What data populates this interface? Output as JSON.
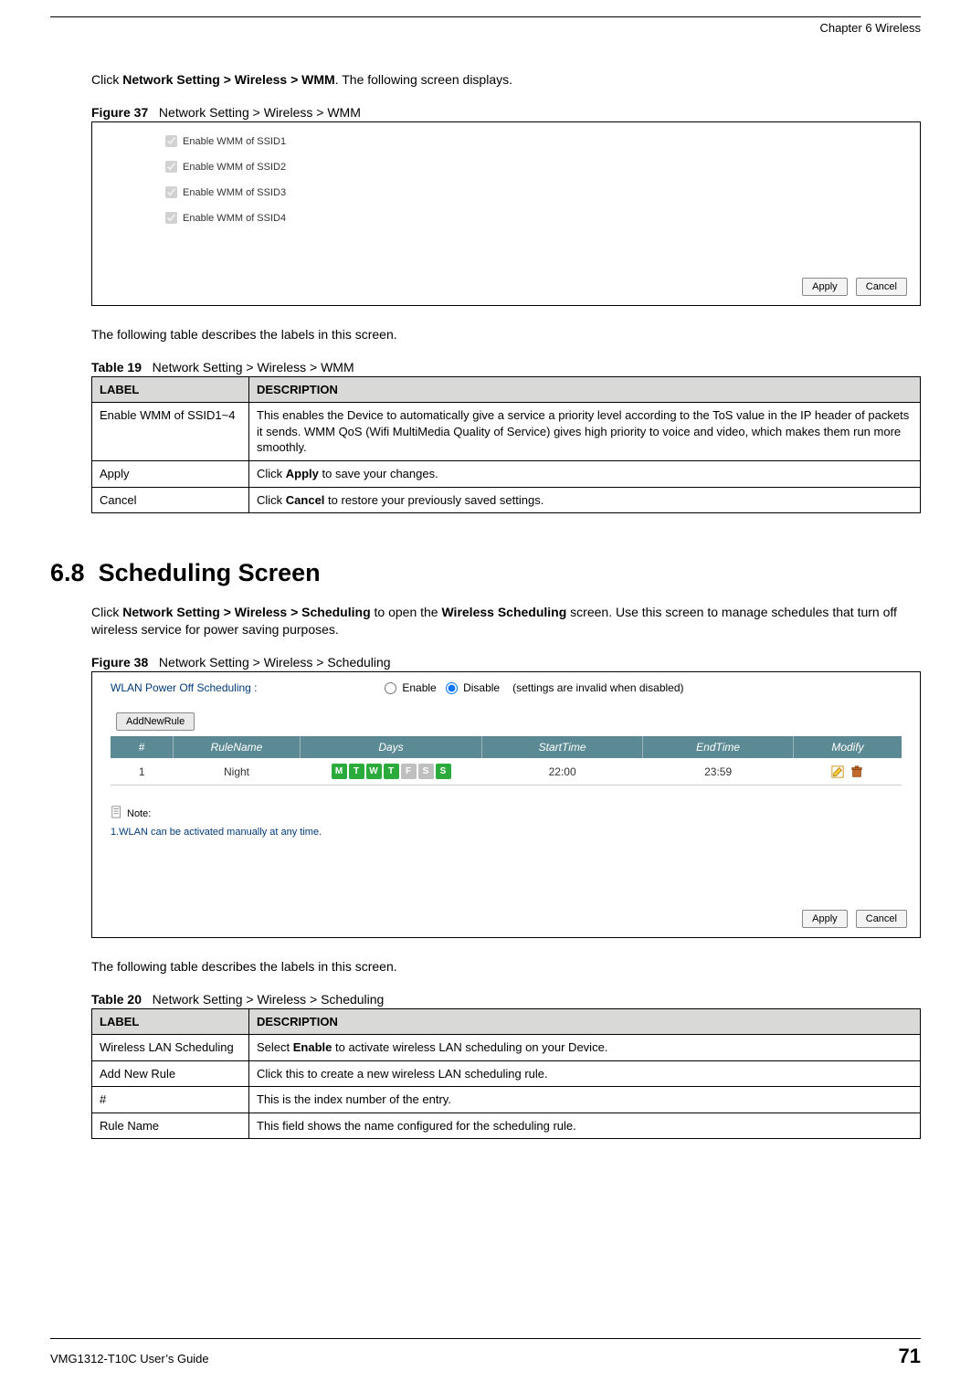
{
  "header": {
    "chapter": "Chapter 6 Wireless"
  },
  "intro1": {
    "prefix": "Click ",
    "boldPath": "Network Setting > Wireless > WMM",
    "suffix": ". The following screen displays."
  },
  "figure37": {
    "label": "Figure 37",
    "title": "Network Setting > Wireless > WMM",
    "checks": [
      "Enable WMM of SSID1",
      "Enable WMM of SSID2",
      "Enable WMM of SSID3",
      "Enable WMM of SSID4"
    ],
    "apply": "Apply",
    "cancel": "Cancel"
  },
  "tableIntro": "The following table describes the labels in this screen.",
  "table19": {
    "label": "Table 19",
    "title": "Network Setting > Wireless > WMM",
    "head": {
      "label": "LABEL",
      "desc": "DESCRIPTION"
    },
    "rows": [
      {
        "l": "Enable WMM of SSID1~4",
        "d": "This enables the Device to automatically give a service a priority level according to the ToS value in the IP header of packets it sends. WMM QoS (Wifi MultiMedia Quality of Service) gives high priority to voice and video, which makes them run more smoothly."
      },
      {
        "l": "Apply",
        "dPrefix": "Click ",
        "dBold": "Apply",
        "dSuffix": " to save your changes."
      },
      {
        "l": "Cancel",
        "dPrefix": "Click ",
        "dBold": "Cancel",
        "dSuffix": " to restore your previously saved settings."
      }
    ]
  },
  "section68": {
    "num": "6.8",
    "title": "Scheduling Screen"
  },
  "intro2": {
    "p1": "Click ",
    "b1": "Network Setting > Wireless > Scheduling",
    "p2": " to open the ",
    "b2": "Wireless Scheduling",
    "p3": " screen. Use this screen to manage schedules that turn off wireless service for power saving purposes."
  },
  "figure38": {
    "label": "Figure 38",
    "title": "Network Setting > Wireless > Scheduling",
    "topLabel": "WLAN Power Off Scheduling :",
    "enable": "Enable",
    "disable": "Disable",
    "disabledHint": "(settings are invalid when disabled)",
    "addBtn": "AddNewRule",
    "cols": {
      "n": "#",
      "rule": "RuleName",
      "days": "Days",
      "start": "StartTime",
      "end": "EndTime",
      "mod": "Modify"
    },
    "row": {
      "n": "1",
      "rule": "Night",
      "days": [
        {
          "t": "M",
          "on": true
        },
        {
          "t": "T",
          "on": true
        },
        {
          "t": "W",
          "on": true
        },
        {
          "t": "T",
          "on": true
        },
        {
          "t": "F",
          "on": false
        },
        {
          "t": "S",
          "on": false
        },
        {
          "t": "S",
          "on": true
        }
      ],
      "start": "22:00",
      "end": "23:59"
    },
    "noteLabel": "Note:",
    "noteText": "1.WLAN can be activated manually at any time.",
    "apply": "Apply",
    "cancel": "Cancel"
  },
  "table20": {
    "label": "Table 20",
    "title": "Network Setting > Wireless > Scheduling",
    "head": {
      "label": "LABEL",
      "desc": "DESCRIPTION"
    },
    "rows": [
      {
        "l": "Wireless LAN Scheduling",
        "dPrefix": "Select ",
        "dBold": "Enable",
        "dSuffix": " to activate wireless LAN scheduling on your Device."
      },
      {
        "l": "Add New Rule",
        "d": "Click this to create a new wireless LAN scheduling rule."
      },
      {
        "l": "#",
        "d": "This is the index number of the entry."
      },
      {
        "l": "Rule Name",
        "d": "This field shows the name configured for the scheduling rule."
      }
    ]
  },
  "footer": {
    "guide": "VMG1312-T10C User’s Guide",
    "page": "71"
  }
}
